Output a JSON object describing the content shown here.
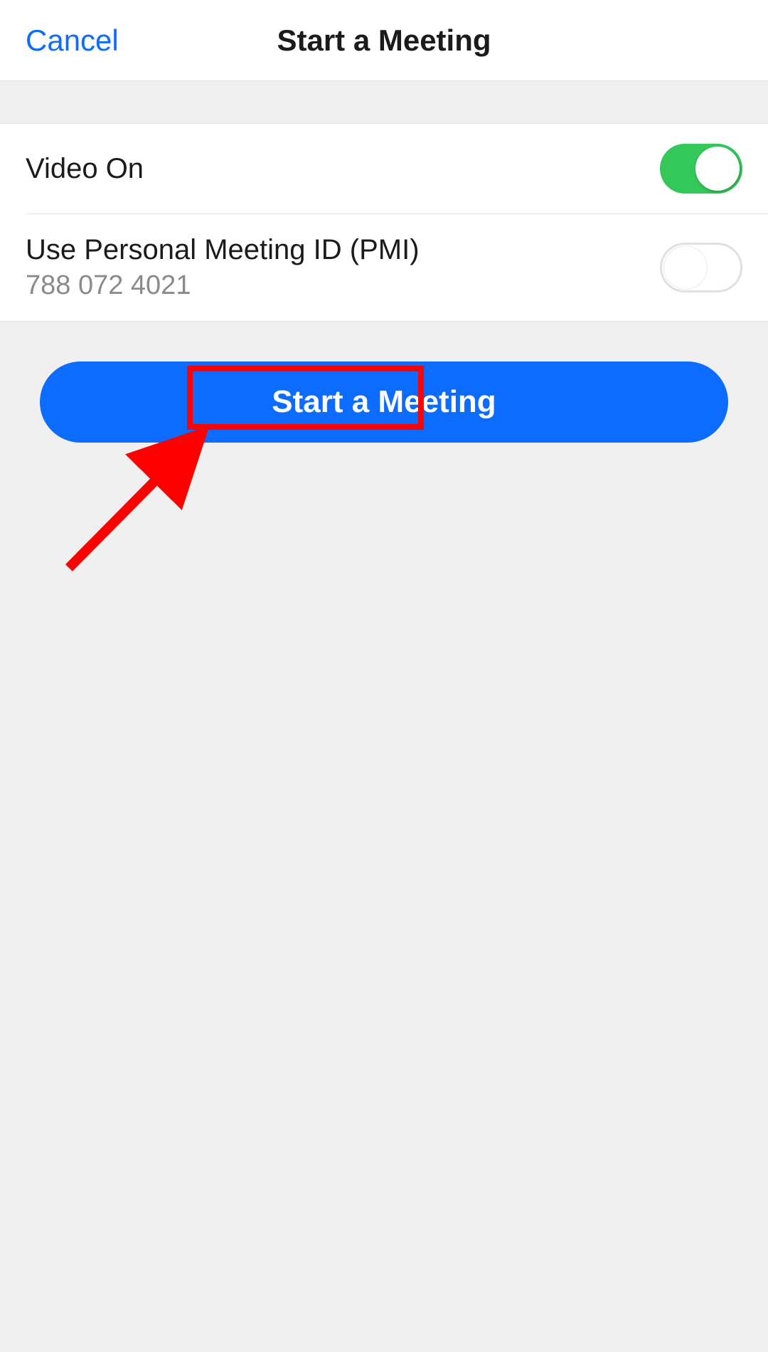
{
  "header": {
    "cancel_label": "Cancel",
    "title": "Start a Meeting"
  },
  "settings": {
    "video_on": {
      "label": "Video On",
      "value": true
    },
    "pmi": {
      "label": "Use Personal Meeting ID (PMI)",
      "id": "788 072 4021",
      "value": false
    }
  },
  "actions": {
    "start_label": "Start a Meeting"
  }
}
